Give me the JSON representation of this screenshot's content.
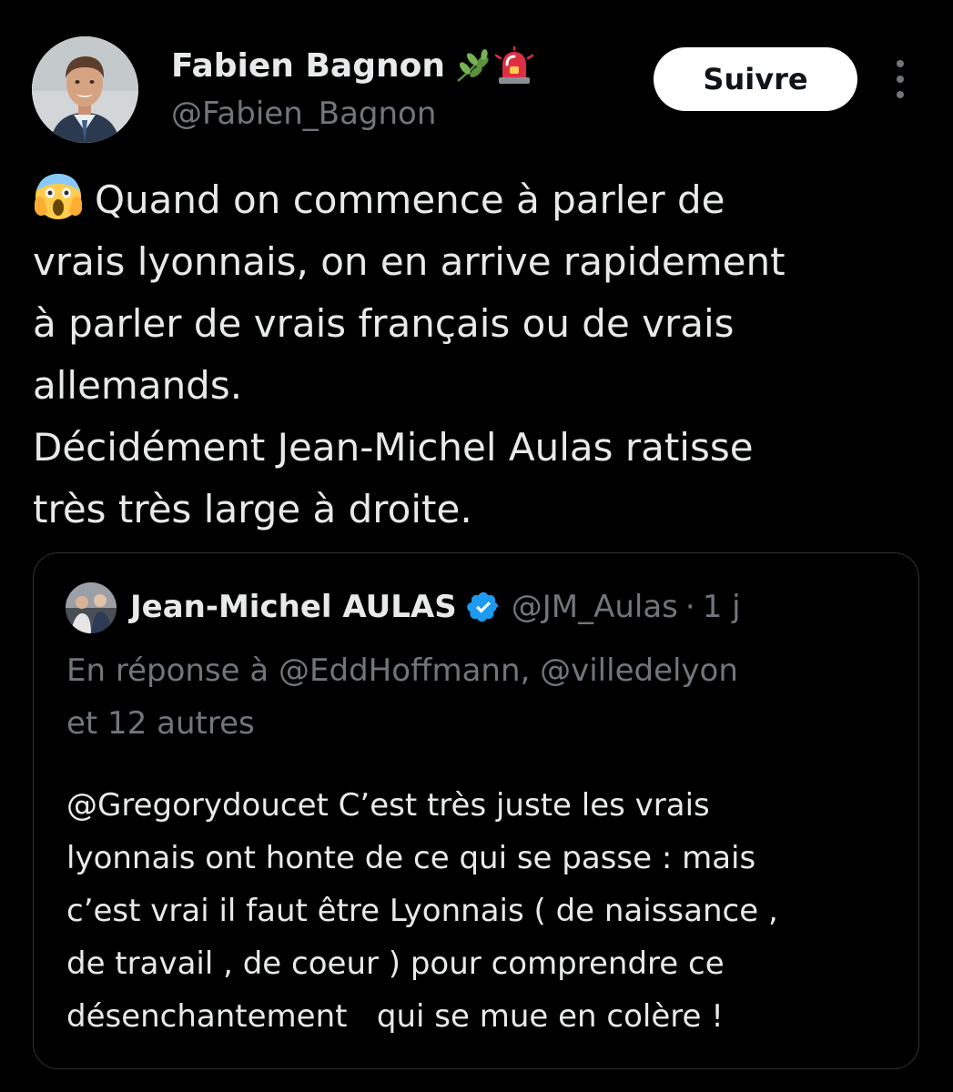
{
  "tweet": {
    "author": {
      "name": "Fabien Bagnon",
      "handle": "@Fabien_Bagnon",
      "badges": [
        "herb-emoji",
        "rotating-light-emoji"
      ]
    },
    "follow_label": "Suivre",
    "emoji": "face-screaming-in-fear-emoji",
    "text_lines": [
      "Quand on commence à parler de",
      "vrais lyonnais, on en arrive rapidement",
      "à parler de vrais français ou de vrais",
      "allemands.",
      "Décidément Jean-Michel Aulas ratisse",
      "très très large à droite."
    ]
  },
  "quote": {
    "author": {
      "name": "Jean-Michel AULAS",
      "verified": true,
      "handle": "@JM_Aulas",
      "separator": "·",
      "time": "1 j"
    },
    "reply_lines": [
      "En réponse à @EddHoffmann, @villedelyon",
      "et 12 autres"
    ],
    "text_lines": [
      "@Gregorydoucet C’est très juste les vrais",
      "lyonnais ont honte de ce qui se passe : mais",
      "c’est vrai il faut être Lyonnais ( de naissance ,",
      "de travail , de coeur ) pour comprendre ce",
      "désenchantement   qui se mue en colère !"
    ]
  },
  "colors": {
    "background": "#000000",
    "text_primary": "#e7e9ea",
    "text_secondary": "#71767b",
    "border": "#2f3336",
    "verified_blue": "#1d9bf0",
    "button_bg": "#ffffff"
  }
}
